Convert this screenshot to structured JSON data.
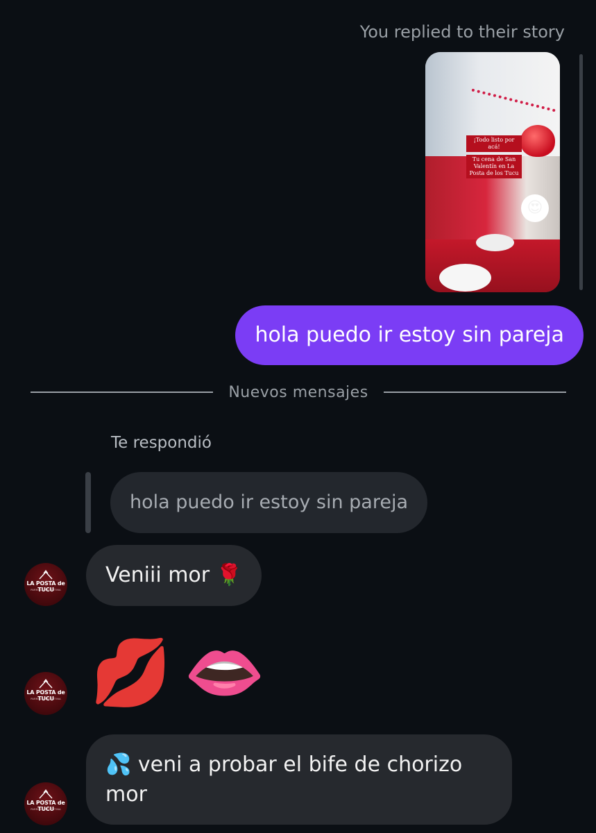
{
  "story_reply": {
    "label": "You replied to their story",
    "caption_lines": [
      "¡Todo listo por acá!",
      "Tu cena de San Valentín en La Posta de los Tucu"
    ],
    "reaction_emoji": "😍"
  },
  "sent_message": "hola puedo ir estoy sin pareja",
  "divider_label": "Nuevos mensajes",
  "reply": {
    "label": "Te respondió",
    "quoted_text": "hola puedo ir estoy sin pareja"
  },
  "received_messages": [
    {
      "text": "Veniii mor 🌹"
    },
    {
      "emojis": [
        "💋",
        "👄"
      ]
    },
    {
      "text": "💦 veni a probar el bife de chorizo mor"
    }
  ],
  "sender_avatar": {
    "brand": "LA POSTA de TUCU",
    "subtitle": "PARRILLA ARGENTINA"
  },
  "colors": {
    "background": "#0b0f14",
    "sent_bubble": "#7b3df5",
    "received_bubble": "#26292e",
    "quoted_bubble": "#23272d",
    "muted_text": "#9aa0a6"
  }
}
